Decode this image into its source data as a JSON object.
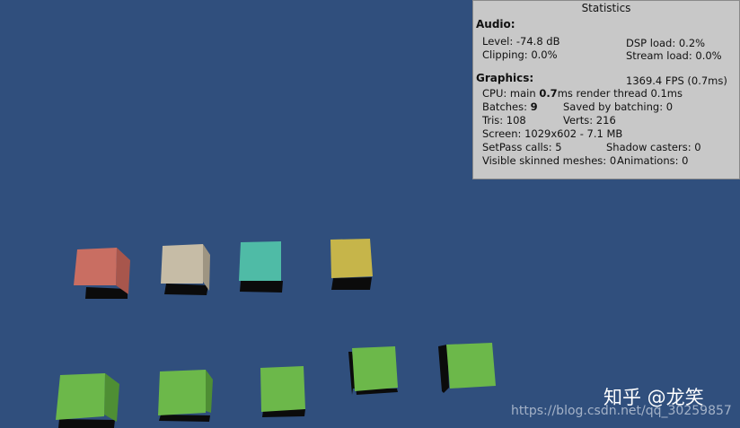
{
  "statistics": {
    "title": "Statistics",
    "audio": {
      "header": "Audio:",
      "level": "Level: -74.8 dB",
      "clipping": "Clipping: 0.0%",
      "dsp_load": "DSP load: 0.2%",
      "stream_load": "Stream load: 0.0%"
    },
    "graphics": {
      "header": "Graphics:",
      "fps": "1369.4 FPS (0.7ms)",
      "cpu_main_prefix": "CPU: main ",
      "cpu_main_value": "0.7",
      "cpu_main_suffix": "ms  render thread 0.1ms",
      "batches_prefix": "Batches: ",
      "batches_value": "9",
      "saved_by_batching": "Saved by batching: 0",
      "tris": "Tris: 108",
      "verts": "Verts: 216",
      "screen": "Screen: 1029x602 - 7.1 MB",
      "setpass_calls": "SetPass calls: 5",
      "shadow_casters": "Shadow casters: 0",
      "visible_skinned_meshes": "Visible skinned meshes: 0",
      "animations": "Animations: 0"
    }
  },
  "scene": {
    "background_color": "#304f7d",
    "shadow_color": "#0b0b0b",
    "top_row_cube_colors": [
      "#c96e62",
      "#c6bca6",
      "#4fbba6",
      "#c6b54a"
    ],
    "bottom_row_cube_color": "#6cb84a"
  },
  "watermark": {
    "zhihu": "知乎 @龙笑",
    "url": "https://blog.csdn.net/qq_30259857"
  }
}
